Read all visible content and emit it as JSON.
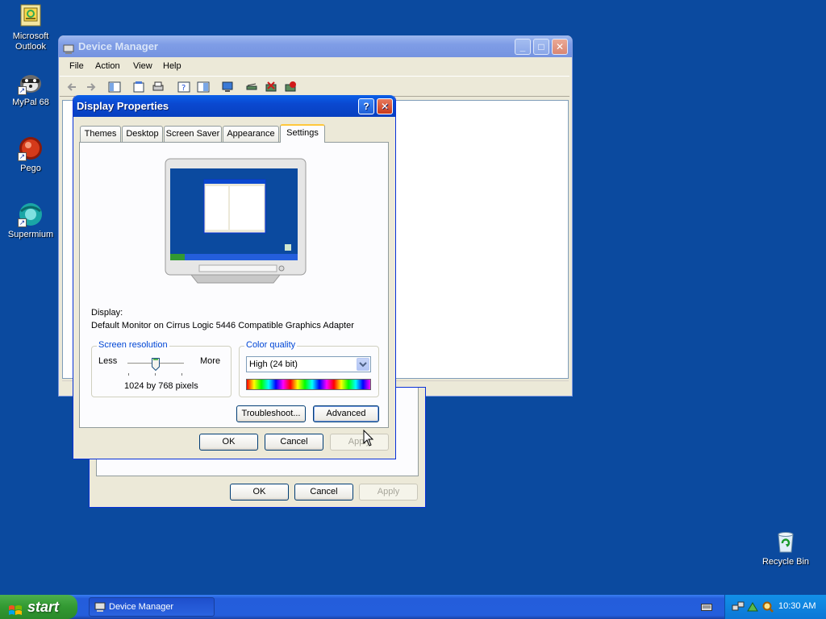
{
  "desktop": {
    "icons": [
      {
        "label": "Microsoft Outlook",
        "line1": "Microsoft",
        "line2": "Outlook"
      },
      {
        "label": "MyPal 68"
      },
      {
        "label": "Pego"
      },
      {
        "label": "Supermium"
      },
      {
        "label": "Recycle Bin"
      }
    ]
  },
  "device_manager": {
    "title": "Device Manager",
    "menu": [
      "File",
      "Action",
      "View",
      "Help"
    ],
    "window_buttons": {
      "minimize": "_",
      "maximize": "□",
      "close": "✕"
    }
  },
  "back_dialog": {
    "ok": "OK",
    "cancel": "Cancel",
    "apply": "Apply"
  },
  "display_properties": {
    "title": "Display Properties",
    "help_button": "?",
    "close_button": "✕",
    "tabs": [
      "Themes",
      "Desktop",
      "Screen Saver",
      "Appearance",
      "Settings"
    ],
    "active_tab": "Settings",
    "display_label": "Display:",
    "display_value": "Default Monitor on Cirrus Logic 5446 Compatible Graphics Adapter",
    "screen_resolution": {
      "label": "Screen resolution",
      "less": "Less",
      "more": "More",
      "value": "1024 by 768 pixels"
    },
    "color_quality": {
      "label": "Color quality",
      "selected": "High (24 bit)"
    },
    "troubleshoot": "Troubleshoot...",
    "advanced": "Advanced",
    "ok": "OK",
    "cancel": "Cancel",
    "apply": "Apply"
  },
  "taskbar": {
    "start": "start",
    "task_label": "Device Manager",
    "clock": "10:30 AM"
  },
  "colors": {
    "desktop": "#0b4a9f",
    "titlebar_active": "#0a48d0",
    "dialog_face": "#ece9d8",
    "start_green": "#329932"
  }
}
